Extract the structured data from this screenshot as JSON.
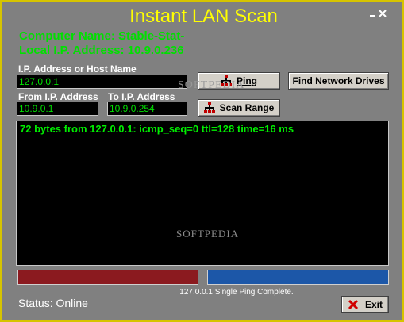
{
  "window": {
    "title": "Instant LAN Scan"
  },
  "info": {
    "computer_name": "Computer Name: Stable-Stat-",
    "local_ip": "Local I.P. Address: 10.9.0.236"
  },
  "host": {
    "label": "I.P. Address or Host Name",
    "value": "127.0.0.1"
  },
  "range": {
    "from_label": "From I.P. Address",
    "from_value": "10.9.0.1",
    "to_label": "To I.P. Address",
    "to_value": "10.9.0.254"
  },
  "buttons": {
    "ping": "Ping",
    "find_drives": "Find Network Drives",
    "scan_range": "Scan Range",
    "exit": "Exit"
  },
  "output": {
    "lines": [
      "72 bytes from 127.0.0.1: icmp_seq=0 ttl=128 time=16 ms"
    ]
  },
  "progress": {
    "message": "127.0.0.1 Single Ping Complete."
  },
  "status": {
    "text": "Status: Online"
  },
  "watermark": {
    "text": "SOFTPEDIA"
  },
  "colors": {
    "title": "#ffff00",
    "info_text": "#00e000",
    "output_text": "#00ee00",
    "bar_left": "#8b1a1f",
    "bar_right": "#1c57a8",
    "border": "#d6c400"
  },
  "icons": [
    "minimize-icon",
    "close-icon",
    "ping-icon",
    "scan-icon",
    "exit-icon"
  ]
}
